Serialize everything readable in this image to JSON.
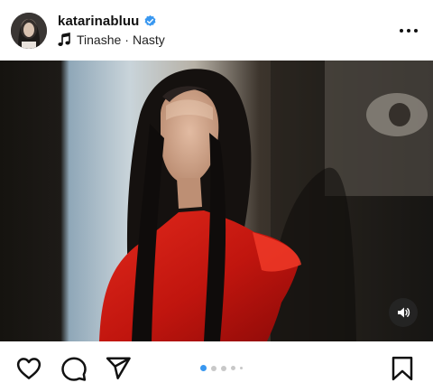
{
  "post": {
    "username": "katarinabluu",
    "verified": true,
    "audio": {
      "artist": "Tinashe",
      "separator": "·",
      "track": "Nasty"
    }
  },
  "media": {
    "description_icon": "video-photo",
    "sound_icon": "speaker-icon"
  },
  "carousel": {
    "active_index": 0,
    "dots": 5
  },
  "actions": {
    "like_icon": "heart-icon",
    "comment_icon": "comment-icon",
    "share_icon": "share-icon",
    "save_icon": "bookmark-icon"
  },
  "colors": {
    "verified_blue": "#3897f0",
    "active_dot": "#3897f0",
    "inactive_dot": "#c8c8c8"
  }
}
